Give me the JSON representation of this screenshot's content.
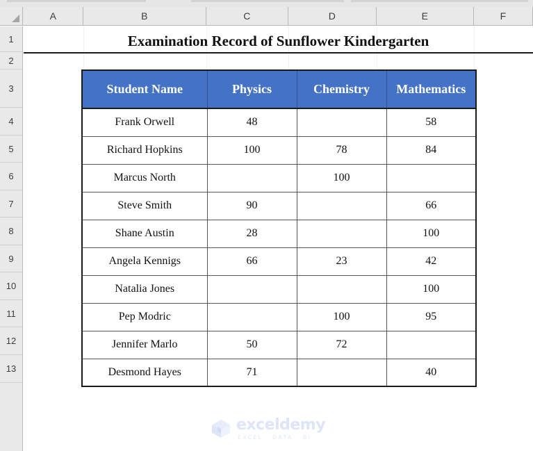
{
  "app": {
    "type": "spreadsheet",
    "accent_blue": "#4472C4",
    "grid_header_bg": "#e9e9e9",
    "watermark_color": "#dde5f7"
  },
  "grid": {
    "column_headers": [
      "A",
      "B",
      "C",
      "D",
      "E",
      "F"
    ],
    "row_headers": [
      "1",
      "2",
      "3",
      "4",
      "5",
      "6",
      "7",
      "8",
      "9",
      "10",
      "11",
      "12",
      "13"
    ],
    "select_all_label": ""
  },
  "sheet": {
    "title": "Examination Record of Sunflower Kindergarten"
  },
  "table": {
    "columns": [
      "Student Name",
      "Physics",
      "Chemistry",
      "Mathematics"
    ],
    "rows": [
      {
        "name": "Frank Orwell",
        "physics": "48",
        "chemistry": "",
        "mathematics": "58"
      },
      {
        "name": "Richard Hopkins",
        "physics": "100",
        "chemistry": "78",
        "mathematics": "84"
      },
      {
        "name": "Marcus North",
        "physics": "",
        "chemistry": "100",
        "mathematics": ""
      },
      {
        "name": "Steve Smith",
        "physics": "90",
        "chemistry": "",
        "mathematics": "66"
      },
      {
        "name": "Shane Austin",
        "physics": "28",
        "chemistry": "",
        "mathematics": "100"
      },
      {
        "name": "Angela Kennigs",
        "physics": "66",
        "chemistry": "23",
        "mathematics": "42"
      },
      {
        "name": "Natalia Jones",
        "physics": "",
        "chemistry": "",
        "mathematics": "100"
      },
      {
        "name": "Pep Modric",
        "physics": "",
        "chemistry": "100",
        "mathematics": "95"
      },
      {
        "name": "Jennifer Marlo",
        "physics": "50",
        "chemistry": "72",
        "mathematics": ""
      },
      {
        "name": "Desmond Hayes",
        "physics": "71",
        "chemistry": "",
        "mathematics": "40"
      }
    ]
  },
  "watermark": {
    "word": "exceldemy",
    "tagline": "EXCEL · DATA · BI"
  }
}
